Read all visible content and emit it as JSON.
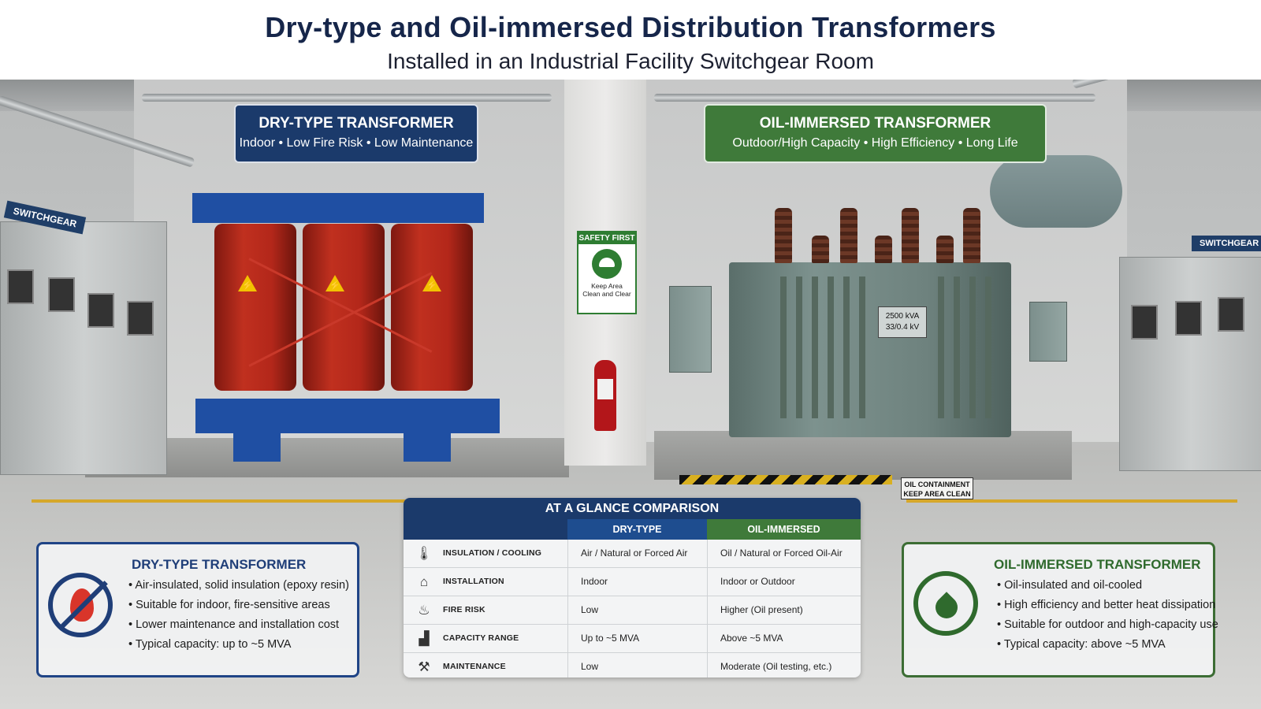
{
  "header": {
    "title": "Dry-type and Oil-immersed Distribution Transformers",
    "subtitle": "Installed in an Industrial Facility Switchgear Room"
  },
  "scene": {
    "switchgear_left_sign": "SWITCHGEAR",
    "switchgear_right_sign": "SWITCHGEAR",
    "safety_sign": {
      "title": "SAFETY FIRST",
      "line1": "Keep Area",
      "line2": "Clean and Clear"
    },
    "nameplate": {
      "rating": "2500 kVA",
      "voltage": "33/0.4 kV"
    },
    "oil_note": {
      "line1": "OIL CONTAINMENT",
      "line2": "KEEP AREA CLEAN"
    }
  },
  "dry_label": {
    "title": "DRY-TYPE TRANSFORMER",
    "tagline": "Indoor • Low Fire Risk • Low Maintenance"
  },
  "oil_label": {
    "title": "OIL-IMMERSED TRANSFORMER",
    "tagline": "Outdoor/High Capacity • High Efficiency • Long Life"
  },
  "dry_box": {
    "title": "DRY-TYPE TRANSFORMER",
    "bullets": [
      "Air-insulated, solid insulation (epoxy resin)",
      "Suitable for indoor, fire-sensitive areas",
      "Lower maintenance and installation cost",
      "Typical capacity: up to ~5 MVA"
    ],
    "icon": "no-fire-icon"
  },
  "oil_box": {
    "title": "OIL-IMMERSED TRANSFORMER",
    "bullets": [
      "Oil-insulated and oil-cooled",
      "High efficiency and better heat dissipation",
      "Suitable for outdoor and high-capacity use",
      "Typical capacity: above ~5 MVA"
    ],
    "icon": "oil-drop-icon"
  },
  "comparison": {
    "title": "AT A GLANCE COMPARISON",
    "columns": [
      "",
      "DRY-TYPE",
      "OIL-IMMERSED"
    ],
    "rows": [
      {
        "icon": "thermometer-icon",
        "label": "INSULATION / COOLING",
        "dry": "Air / Natural or Forced Air",
        "oil": "Oil / Natural or Forced Oil-Air"
      },
      {
        "icon": "house-icon",
        "label": "INSTALLATION",
        "dry": "Indoor",
        "oil": "Indoor or Outdoor"
      },
      {
        "icon": "flame-icon",
        "label": "FIRE RISK",
        "dry": "Low",
        "oil": "Higher (Oil present)"
      },
      {
        "icon": "bar-chart-icon",
        "label": "CAPACITY RANGE",
        "dry": "Up to ~5 MVA",
        "oil": "Above ~5 MVA"
      },
      {
        "icon": "wrench-icon",
        "label": "MAINTENANCE",
        "dry": "Low",
        "oil": "Moderate (Oil testing, etc.)"
      }
    ]
  },
  "colors": {
    "navy": "#1b3a6b",
    "green": "#3f7a3a",
    "coil_red": "#b3271a",
    "frame_blue": "#1f4fa3"
  }
}
